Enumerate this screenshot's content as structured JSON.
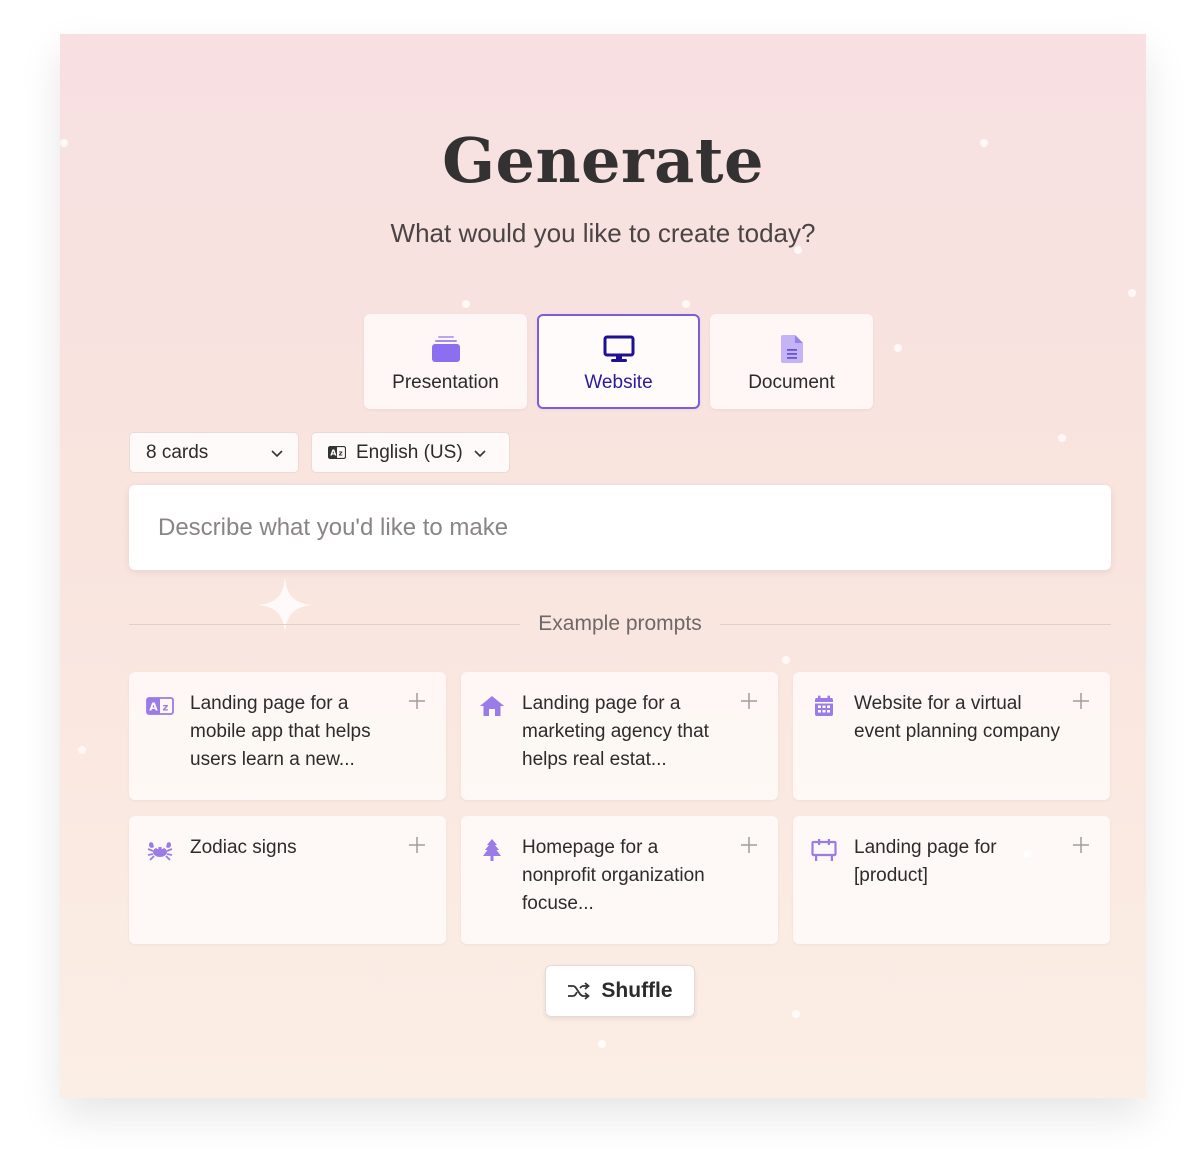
{
  "header": {
    "title": "Generate",
    "subtitle": "What would you like to create today?"
  },
  "modes": [
    {
      "label": "Presentation",
      "icon": "presentation-icon",
      "active": false
    },
    {
      "label": "Website",
      "icon": "monitor-icon",
      "active": true
    },
    {
      "label": "Document",
      "icon": "document-icon",
      "active": false
    }
  ],
  "controls": {
    "cards_select": "8 cards",
    "language_select": "English (US)"
  },
  "prompt": {
    "placeholder": "Describe what you'd like to make",
    "value": ""
  },
  "examples": {
    "heading": "Example prompts",
    "items": [
      {
        "text": "Landing page for a mobile app that helps users learn a new...",
        "icon": "translate-icon"
      },
      {
        "text": "Landing page for a marketing agency that helps real estat...",
        "icon": "house-icon"
      },
      {
        "text": "Website for a virtual event planning company",
        "icon": "calendar-icon"
      },
      {
        "text": "Zodiac signs",
        "icon": "crab-icon"
      },
      {
        "text": "Homepage for a nonprofit organization focuse...",
        "icon": "tree-icon"
      },
      {
        "text": "Landing page for [product]",
        "icon": "billboard-icon"
      }
    ]
  },
  "shuffle_label": "Shuffle",
  "colors": {
    "accent": "#7b5ee0",
    "accent_dark": "#2a1b9e",
    "icon_purple": "#9a7be8"
  }
}
